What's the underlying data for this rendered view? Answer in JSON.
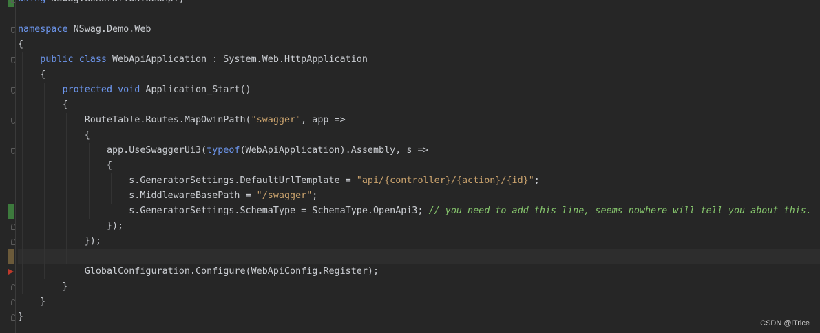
{
  "editor": {
    "lines": [
      {
        "tokens": [
          {
            "t": "using",
            "c": "kw"
          },
          {
            "t": " NSwag.Generation.WebApi;"
          }
        ]
      },
      {
        "tokens": []
      },
      {
        "tokens": [
          {
            "t": "namespace",
            "c": "kw"
          },
          {
            "t": " NSwag.Demo.Web"
          }
        ]
      },
      {
        "tokens": [
          {
            "t": "{"
          }
        ]
      },
      {
        "tokens": [
          {
            "t": "    "
          },
          {
            "t": "public",
            "c": "kw"
          },
          {
            "t": " "
          },
          {
            "t": "class",
            "c": "kw"
          },
          {
            "t": " WebApiApplication : System.Web.HttpApplication"
          }
        ]
      },
      {
        "tokens": [
          {
            "t": "    {"
          }
        ]
      },
      {
        "tokens": [
          {
            "t": "        "
          },
          {
            "t": "protected",
            "c": "kw"
          },
          {
            "t": " "
          },
          {
            "t": "void",
            "c": "kw"
          },
          {
            "t": " Application_Start()"
          }
        ]
      },
      {
        "tokens": [
          {
            "t": "        {"
          }
        ]
      },
      {
        "tokens": [
          {
            "t": "            RouteTable.Routes.MapOwinPath("
          },
          {
            "t": "\"swagger\"",
            "c": "str"
          },
          {
            "t": ", app =>"
          }
        ]
      },
      {
        "tokens": [
          {
            "t": "            {"
          }
        ]
      },
      {
        "tokens": [
          {
            "t": "                app.UseSwaggerUi3("
          },
          {
            "t": "typeof",
            "c": "kw"
          },
          {
            "t": "(WebApiApplication).Assembly, s =>"
          }
        ]
      },
      {
        "tokens": [
          {
            "t": "                {"
          }
        ]
      },
      {
        "tokens": [
          {
            "t": "                    s.GeneratorSettings.DefaultUrlTemplate = "
          },
          {
            "t": "\"api/{controller}/{action}/{id}\"",
            "c": "str"
          },
          {
            "t": ";"
          }
        ]
      },
      {
        "tokens": [
          {
            "t": "                    s.MiddlewareBasePath = "
          },
          {
            "t": "\"/swagger\"",
            "c": "str"
          },
          {
            "t": ";"
          }
        ]
      },
      {
        "tokens": [
          {
            "t": "                    s.GeneratorSettings.SchemaType = SchemaType.OpenApi3; "
          },
          {
            "t": "// you need to add this line, seems nowhere will tell you about this.",
            "c": "cm"
          }
        ]
      },
      {
        "tokens": [
          {
            "t": "                });"
          }
        ]
      },
      {
        "tokens": [
          {
            "t": "            });"
          }
        ]
      },
      {
        "tokens": []
      },
      {
        "tokens": [
          {
            "t": "            GlobalConfiguration.Configure(WebApiConfig.Register);"
          }
        ]
      },
      {
        "tokens": [
          {
            "t": "        }"
          }
        ]
      },
      {
        "tokens": [
          {
            "t": "    }"
          }
        ]
      },
      {
        "tokens": [
          {
            "t": "}"
          }
        ]
      }
    ],
    "current_line": 18,
    "fold_markers": [
      {
        "line": 1,
        "type": "close"
      },
      {
        "line": 3,
        "type": "open"
      },
      {
        "line": 5,
        "type": "open"
      },
      {
        "line": 7,
        "type": "open"
      },
      {
        "line": 9,
        "type": "open"
      },
      {
        "line": 11,
        "type": "open"
      },
      {
        "line": 16,
        "type": "close"
      },
      {
        "line": 17,
        "type": "close"
      },
      {
        "line": 20,
        "type": "close"
      },
      {
        "line": 21,
        "type": "close"
      },
      {
        "line": 22,
        "type": "close"
      }
    ],
    "change_marks": [
      {
        "line": 1,
        "color": "#3d7a3d"
      },
      {
        "line": 15,
        "color": "#3d7a3d"
      },
      {
        "line": 18,
        "color": "#6b5a3a"
      }
    ],
    "breakpoint_line": 19
  },
  "watermark": "CSDN @iTrice",
  "colors": {
    "background": "#262626",
    "keyword": "#6c95eb",
    "string": "#c9a26d",
    "comment": "#85c46c",
    "text": "#c9ccd1"
  }
}
